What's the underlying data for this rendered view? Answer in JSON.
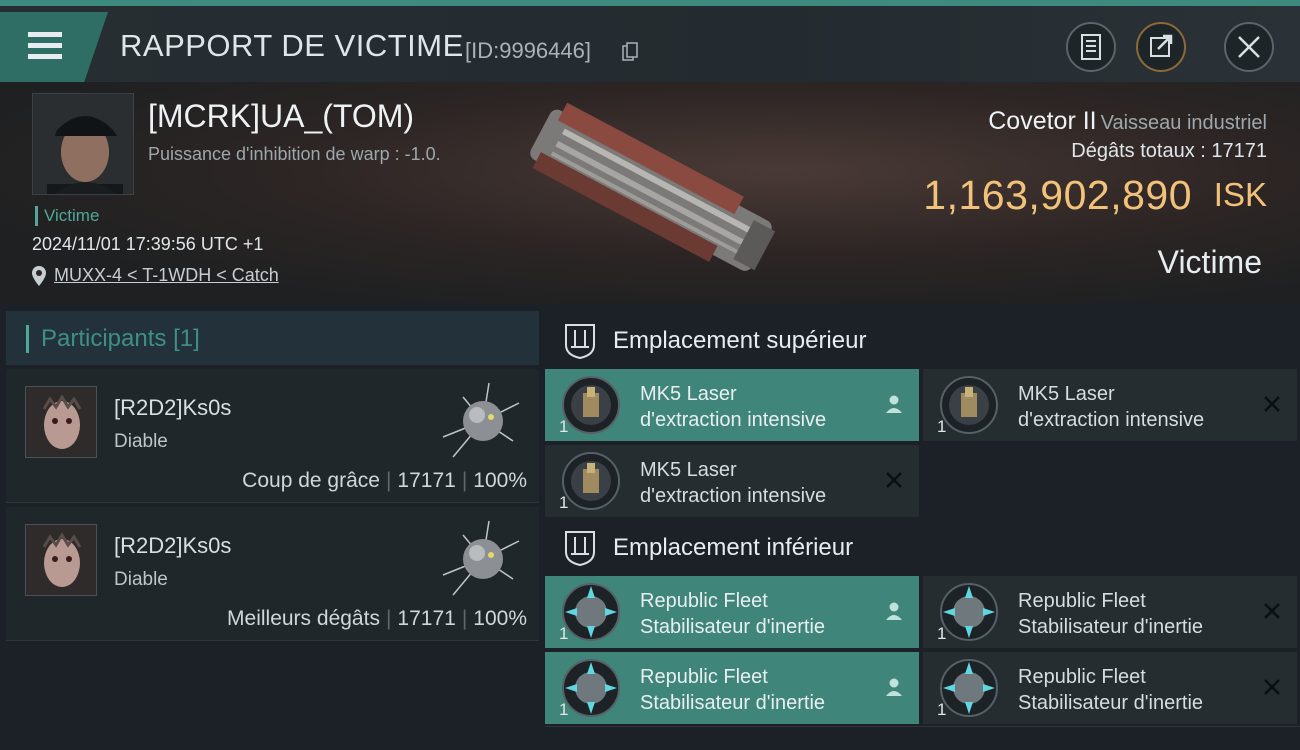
{
  "header": {
    "title": "RAPPORT DE VICTIME",
    "id_label": "[ID:9996446]",
    "icons": [
      "menu-icon",
      "copy-icon",
      "document-icon",
      "share-icon",
      "close-icon"
    ]
  },
  "victim": {
    "name": "[MCRK]UA_(TOM)",
    "warp_text": "Puissance d'inhibition de warp : -1.0.",
    "tag": "Victime",
    "datetime": "2024/11/01 17:39:56 UTC +1",
    "location": "MUXX-4 < T-1WDH < Catch",
    "ship_name": "Covetor II",
    "ship_type": "Vaisseau industriel",
    "damage_label": "Dégâts totaux :",
    "damage_total": "17171",
    "isk_value": "1,163,902,890",
    "isk_unit": "ISK",
    "role": "Victime"
  },
  "participants": {
    "label": "Participants",
    "count": "[1]",
    "items": [
      {
        "name": "[R2D2]Ks0s",
        "role": "Diable",
        "stat_label": "Coup de grâce",
        "damage": "17171",
        "percent": "100%"
      },
      {
        "name": "[R2D2]Ks0s",
        "role": "Diable",
        "stat_label": "Meilleurs dégâts",
        "damage": "17171",
        "percent": "100%"
      }
    ]
  },
  "slots": [
    {
      "label": "Emplacement supérieur",
      "modules": [
        {
          "qty": "1",
          "line1": "MK5 Laser",
          "line2": "d'extraction intensive",
          "status": "fitted"
        },
        {
          "qty": "1",
          "line1": "MK5 Laser",
          "line2": "d'extraction intensive",
          "status": "destroyed"
        },
        {
          "qty": "1",
          "line1": "MK5 Laser",
          "line2": "d'extraction intensive",
          "status": "destroyed"
        }
      ]
    },
    {
      "label": "Emplacement inférieur",
      "modules": [
        {
          "qty": "1",
          "line1": "Republic Fleet",
          "line2": "Stabilisateur d'inertie",
          "status": "fitted"
        },
        {
          "qty": "1",
          "line1": "Republic Fleet",
          "line2": "Stabilisateur d'inertie",
          "status": "destroyed"
        },
        {
          "qty": "1",
          "line1": "Republic Fleet",
          "line2": "Stabilisateur d'inertie",
          "status": "fitted"
        },
        {
          "qty": "1",
          "line1": "Republic Fleet",
          "line2": "Stabilisateur d'inertie",
          "status": "destroyed"
        }
      ]
    }
  ],
  "colors": {
    "accent": "#3f8579",
    "isk": "#f3c27a",
    "teal_text": "#4fa89a"
  }
}
